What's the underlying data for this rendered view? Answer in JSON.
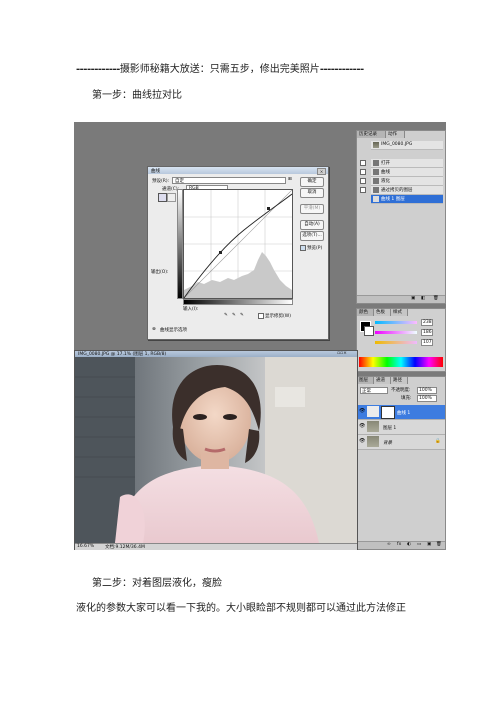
{
  "document": {
    "title_dash_left": "------------",
    "title_text": "摄影师秘籍大放送：只需五步，修出完美照片",
    "title_dash_right": "------------",
    "step1_heading": "第一步：曲线拉对比",
    "step2_heading": "第二步：对着图层液化，瘦脸",
    "step2_description": "液化的参数大家可以看一下我的。大小眼睑部不规则都可以通过此方法修正"
  },
  "screenshot": {
    "curves_dialog": {
      "title": "曲线",
      "preset_label": "预设(R):",
      "preset_value": "自定",
      "channel_label": "通道(C):",
      "channel_value": "RGB",
      "buttons": [
        "确定",
        "取消",
        "平滑(M)",
        "自动(A)",
        "选项(T)..."
      ],
      "preview_label": "预览(P)",
      "output_label": "输出(O):",
      "input_label": "输入(I):",
      "clipping_label": "显示修剪(W)",
      "show_amount_label": "曲线显示选项"
    },
    "photo_window": {
      "title": "IMG_0080.JPG @ 17.1% (图层 1, RGB/8)",
      "zoom": "16.67%",
      "doc_info": "文档:9.12M/36.4M"
    },
    "history_panel": {
      "tabs": [
        "历史记录",
        "动作"
      ],
      "snapshot": "IMG_0080.JPG",
      "items": [
        "打开",
        "曲线",
        "液化",
        "通过拷贝的图层",
        "曲线 1 图层"
      ]
    },
    "layers_panel": {
      "tabs": [
        "图层",
        "通道",
        "路径"
      ],
      "blend_mode": "正常",
      "opacity_label": "不透明度:",
      "opacity": "100%",
      "fill_label": "填充:",
      "fill": "100%",
      "layers": [
        "曲线 1",
        "图层 1",
        "背景"
      ]
    },
    "color_panel": {
      "tabs": [
        "颜色",
        "色板",
        "样式"
      ],
      "values": [
        "238",
        "186",
        "107"
      ]
    }
  }
}
